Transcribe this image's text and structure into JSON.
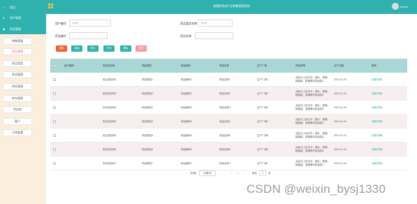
{
  "header": {
    "title": "新疆特色农产品销售管理系统",
    "user_name": "admin"
  },
  "sidebar": {
    "top_items": [
      {
        "icon": "home-icon",
        "label": "首页"
      },
      {
        "icon": "user-icon",
        "label": "用户管理"
      },
      {
        "icon": "settings-icon",
        "label": "药业管理"
      }
    ],
    "buttons": [
      {
        "label": "销售管理",
        "active": false
      },
      {
        "label": "药品管理",
        "active": true
      },
      {
        "label": "药品类型",
        "active": false
      },
      {
        "label": "药品管理",
        "active": false
      },
      {
        "label": "供应管理",
        "active": false
      },
      {
        "label": "库存管理",
        "active": false
      },
      {
        "label": "供应商",
        "active": false
      },
      {
        "label": "客户",
        "active": false
      },
      {
        "label": "订单查看",
        "active": false
      }
    ]
  },
  "search": {
    "label_1": "用户编号",
    "placeholder_1": "请选择",
    "label_2": "药品类型名称",
    "placeholder_2": "请选择",
    "label_3": "药品编号",
    "placeholder_3": "",
    "label_4": "药品名称",
    "placeholder_4": ""
  },
  "actions": [
    {
      "label": "搜索",
      "color": "#f0622e"
    },
    {
      "label": "新增",
      "color": "#2fb2ad"
    },
    {
      "label": "导出",
      "color": "#2fb2ad"
    },
    {
      "label": "打印",
      "color": "#2fb2ad"
    },
    {
      "label": "删除",
      "color": "#2fb2ad"
    },
    {
      "label": "修改",
      "color": "#f29c9c"
    }
  ],
  "table": {
    "columns": [
      "用户编号",
      "供应商名称",
      "药品类型",
      "药品编号",
      "药品名称",
      "生产厂家",
      "药品声明",
      "生产日期",
      "操作"
    ],
    "rows": [
      {
        "supplier": "供应商名称1",
        "type": "药品类型1",
        "code": "药品编号1",
        "name": "药品名称1",
        "maker": "生产厂家1",
        "desc": "此处可上传文字、图片、视频、超链接、表格等内容信息1",
        "date": "2022-11-03",
        "op": "查看详情1"
      },
      {
        "supplier": "供应商名称2",
        "type": "药品类型2",
        "code": "药品编号2",
        "name": "药品名称2",
        "maker": "生产厂家2",
        "desc": "此处可上传文字、图片、视频、超链接、表格等内容信息2",
        "date": "2022-11-03",
        "op": "查看详情2"
      },
      {
        "supplier": "供应商名称3",
        "type": "药品类型3",
        "code": "药品编号3",
        "name": "药品名称3",
        "maker": "生产厂家3",
        "desc": "此处可上传文字、图片、视频、超链接、表格等内容信息3",
        "date": "2022-11-03",
        "op": "查看详情3"
      },
      {
        "supplier": "供应商名称4",
        "type": "药品类型4",
        "code": "药品编号4",
        "name": "药品名称4",
        "maker": "生产厂家4",
        "desc": "此处可上传文字、图片、视频、超链接、表格等内容信息4",
        "date": "2022-11-03",
        "op": "查看详情4"
      },
      {
        "supplier": "供应商名称5",
        "type": "药品类型5",
        "code": "药品编号5",
        "name": "药品名称5",
        "maker": "生产厂家5",
        "desc": "此处可上传文字、图片、视频、超链接、表格等内容信息5",
        "date": "2022-11-03",
        "op": "查看详情5"
      },
      {
        "supplier": "供应商名称6",
        "type": "药品类型6",
        "code": "药品编号6",
        "name": "药品名称6",
        "maker": "生产厂家6",
        "desc": "此处可上传文字、图片、视频、超链接、表格等内容信息6",
        "date": "2022-11-03",
        "op": "查看详情6"
      },
      {
        "supplier": "供应商名称7",
        "type": "药品类型7",
        "code": "药品编号7",
        "name": "药品名称7",
        "maker": "生产厂家7",
        "desc": "此处可上传文字、图片、视频、超链接、表格等内容信息7",
        "date": "2022-11-03",
        "op": "查看详情7"
      }
    ]
  },
  "pagination": {
    "total": "共6条",
    "page_size": "10条/页",
    "prev": "‹",
    "page": "1",
    "next": "›",
    "goto_label": "前往",
    "goto_value": "1",
    "page_suffix": "页"
  },
  "watermark": "CSDN @weixin_bysj1330"
}
